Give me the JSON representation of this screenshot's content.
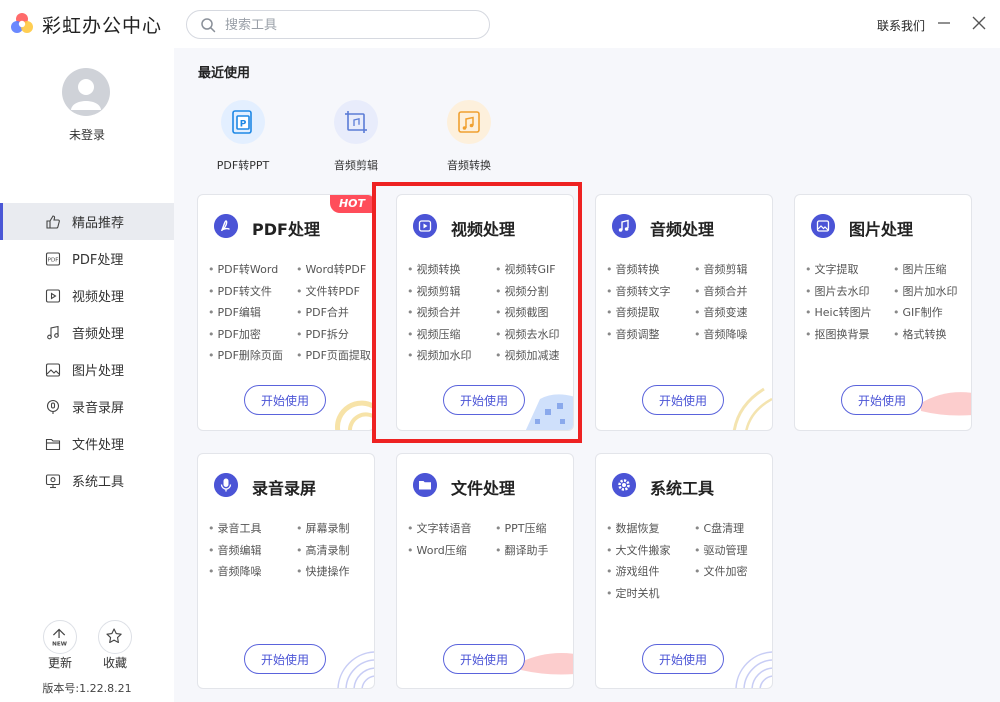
{
  "app": {
    "title": "彩虹办公中心"
  },
  "search": {
    "placeholder": "搜索工具"
  },
  "header": {
    "contact_label": "联系我们"
  },
  "user": {
    "status": "未登录"
  },
  "sidebar": {
    "items": [
      {
        "label": "精品推荐",
        "icon": "thumb-up-icon",
        "active": true
      },
      {
        "label": "PDF处理",
        "icon": "pdf-icon"
      },
      {
        "label": "视频处理",
        "icon": "video-icon"
      },
      {
        "label": "音频处理",
        "icon": "music-icon"
      },
      {
        "label": "图片处理",
        "icon": "image-icon"
      },
      {
        "label": "录音录屏",
        "icon": "mic-icon"
      },
      {
        "label": "文件处理",
        "icon": "folder-icon"
      },
      {
        "label": "系统工具",
        "icon": "monitor-icon"
      }
    ],
    "update_label": "更新",
    "update_badge": "NEW",
    "favorite_label": "收藏",
    "version": "版本号:1.22.8.21"
  },
  "recent": {
    "title": "最近使用",
    "items": [
      {
        "label": "PDF转PPT",
        "icon": "ppt-icon",
        "color": "#1e88e5"
      },
      {
        "label": "音频剪辑",
        "icon": "crop-icon",
        "color": "#5b7cd6"
      },
      {
        "label": "音频转换",
        "icon": "music-convert-icon",
        "color": "#f0a030"
      }
    ]
  },
  "cards": [
    {
      "title": "PDF处理",
      "icon": "pdf-icon",
      "hot": "HOT",
      "features": [
        "PDF转Word",
        "Word转PDF",
        "PDF转文件",
        "文件转PDF",
        "PDF编辑",
        "PDF合并",
        "PDF加密",
        "PDF拆分",
        "PDF删除页面",
        "PDF页面提取"
      ],
      "button": "开始使用"
    },
    {
      "title": "视频处理",
      "icon": "play-icon",
      "features": [
        "视频转换",
        "视频转GIF",
        "视频剪辑",
        "视频分割",
        "视频合并",
        "视频截图",
        "视频压缩",
        "视频去水印",
        "视频加水印",
        "视频加减速"
      ],
      "button": "开始使用"
    },
    {
      "title": "音频处理",
      "icon": "music-icon",
      "features": [
        "音频转换",
        "音频剪辑",
        "音频转文字",
        "音频合并",
        "音频提取",
        "音频变速",
        "音频调整",
        "音频降噪"
      ],
      "button": "开始使用"
    },
    {
      "title": "图片处理",
      "icon": "image-icon",
      "features": [
        "文字提取",
        "图片压缩",
        "图片去水印",
        "图片加水印",
        "Heic转图片",
        "GIF制作",
        "抠图换背景",
        "格式转换"
      ],
      "button": "开始使用"
    },
    {
      "title": "录音录屏",
      "icon": "mic-icon",
      "features": [
        "录音工具",
        "屏幕录制",
        "音频编辑",
        "高清录制",
        "音频降噪",
        "快捷操作"
      ],
      "button": "开始使用"
    },
    {
      "title": "文件处理",
      "icon": "folder-icon",
      "features": [
        "文字转语音",
        "PPT压缩",
        "Word压缩",
        "翻译助手"
      ],
      "button": "开始使用"
    },
    {
      "title": "系统工具",
      "icon": "gear-icon",
      "features": [
        "数据恢复",
        "C盘清理",
        "大文件搬家",
        "驱动管理",
        "游戏组件",
        "文件加密",
        "定时关机"
      ],
      "button": "开始使用"
    }
  ],
  "colors": {
    "accent": "#4b54d6",
    "hot": "#ff4d5a",
    "highlight": "#ee2222"
  }
}
